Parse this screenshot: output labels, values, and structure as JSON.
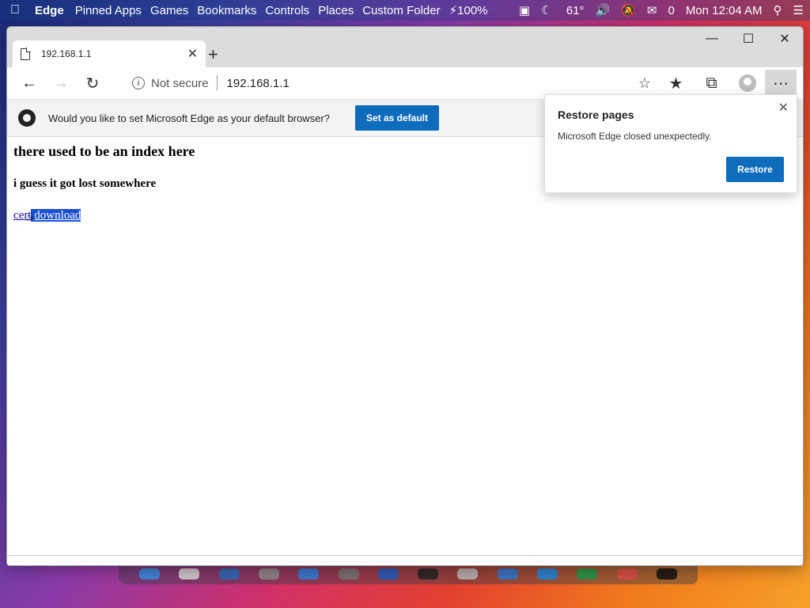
{
  "menubar": {
    "apple_icon": "apple-icon",
    "app_name": "Edge",
    "items": [
      "Pinned Apps",
      "Games",
      "Bookmarks",
      "Controls",
      "Places",
      "Custom Folder"
    ],
    "battery": "100%",
    "weather": "61°",
    "mail_count": "0",
    "clock": "Mon 12:04 AM"
  },
  "tab": {
    "title": "192.168.1.1"
  },
  "address": {
    "security": "Not secure",
    "url": "192.168.1.1"
  },
  "infobar": {
    "message": "Would you like to set Microsoft Edge as your default browser?",
    "button": "Set as default"
  },
  "page": {
    "heading": "there used to be an index here",
    "subheading": "i guess it got lost somewhere",
    "link_cert": "cert",
    "link_download": "download"
  },
  "popup": {
    "title": "Restore pages",
    "message": "Microsoft Edge closed unexpectedly.",
    "button": "Restore"
  },
  "colors": {
    "accent": "#0f6cbd",
    "selection": "#1a4fd6",
    "link": "#1a0dab"
  }
}
